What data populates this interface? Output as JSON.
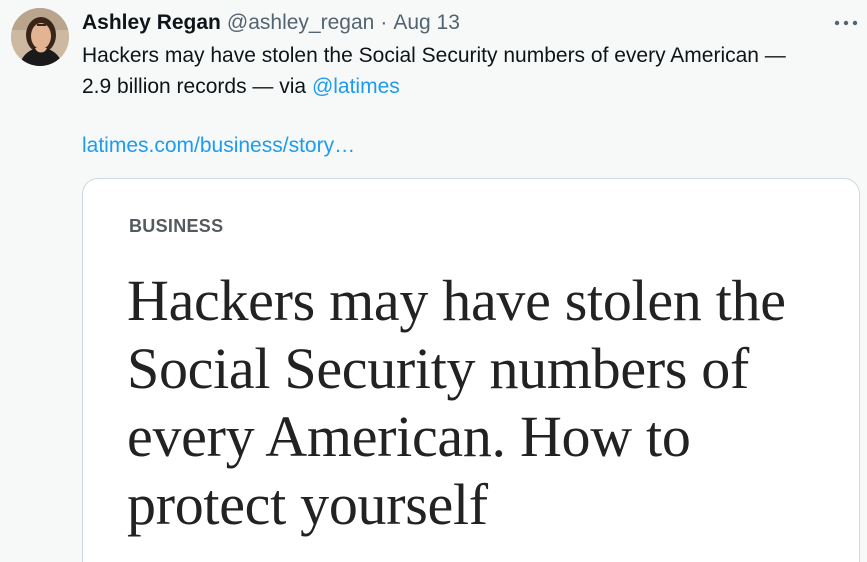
{
  "tweet": {
    "author": {
      "display_name": "Ashley Regan",
      "handle": "@ashley_regan",
      "avatar_icon": "profile-photo"
    },
    "separator": "·",
    "date": "Aug 13",
    "more_icon": "more-horizontal-icon",
    "text": {
      "line1": "Hackers may have stolen the Social Security numbers of every American —",
      "line2_prefix": "2.9 billion records — via ",
      "mention": "@latimes"
    },
    "link": "latimes.com/business/story…",
    "card": {
      "section": "BUSINESS",
      "headline": "Hackers may have stolen the Social Security numbers of every American. How to protect yourself"
    }
  },
  "colors": {
    "background": "#f7f9f9",
    "link": "#1d9bf0",
    "text": "#0f1419",
    "muted": "#536471",
    "card_border": "#cfd9de"
  }
}
